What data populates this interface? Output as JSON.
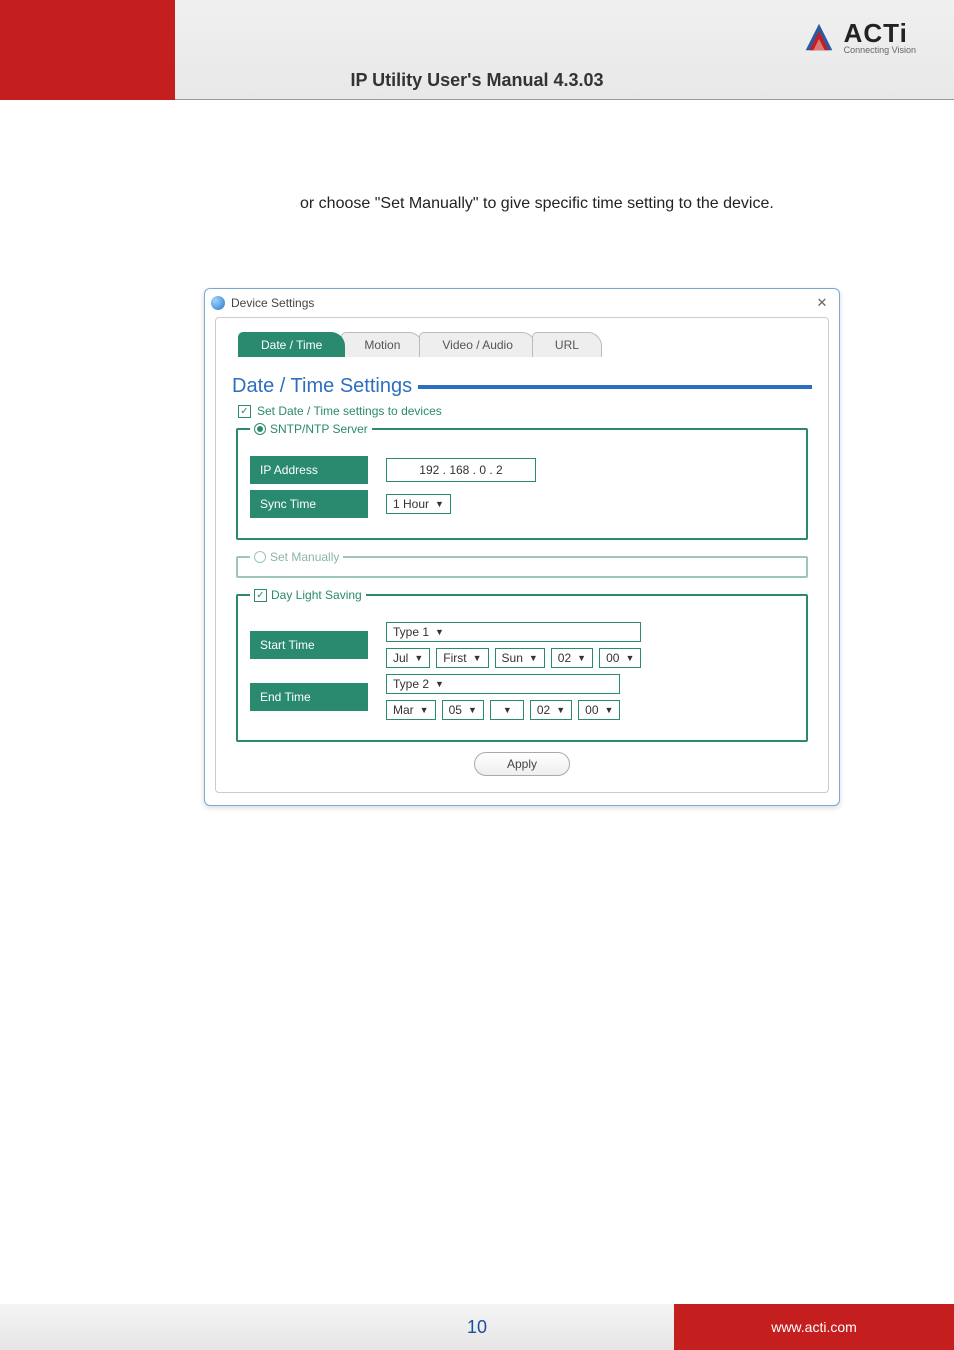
{
  "header": {
    "manual_title": "IP Utility User's Manual 4.3.03",
    "logo_name": "ACTi",
    "logo_tagline": "Connecting Vision"
  },
  "body": {
    "intro_text": "or choose \"Set Manually\" to give specific time setting to the device."
  },
  "dialog": {
    "title": "Device Settings",
    "tabs": {
      "date_time": "Date / Time",
      "motion": "Motion",
      "video_audio": "Video / Audio",
      "url": "URL"
    },
    "section_heading": "Date / Time Settings",
    "set_to_devices_label": "Set Date / Time settings to devices",
    "sntp": {
      "legend": "SNTP/NTP Server",
      "ip_label": "IP Address",
      "ip_value": "192  .  168  .   0   .   2",
      "sync_label": "Sync Time",
      "sync_value": "1 Hour"
    },
    "manual_legend": "Set Manually",
    "dls": {
      "legend": "Day Light Saving",
      "start_label": "Start Time",
      "start_type": "Type 1",
      "start_fields": {
        "month": "Jul",
        "ordinal": "First",
        "day": "Sun",
        "hour": "02",
        "minute": "00"
      },
      "end_label": "End Time",
      "end_type": "Type 2",
      "end_fields": {
        "month": "Mar",
        "dom": "05",
        "blank": "",
        "hour": "02",
        "minute": "00"
      }
    },
    "apply_label": "Apply"
  },
  "footer": {
    "page_number": "10",
    "url": "www.acti.com"
  }
}
